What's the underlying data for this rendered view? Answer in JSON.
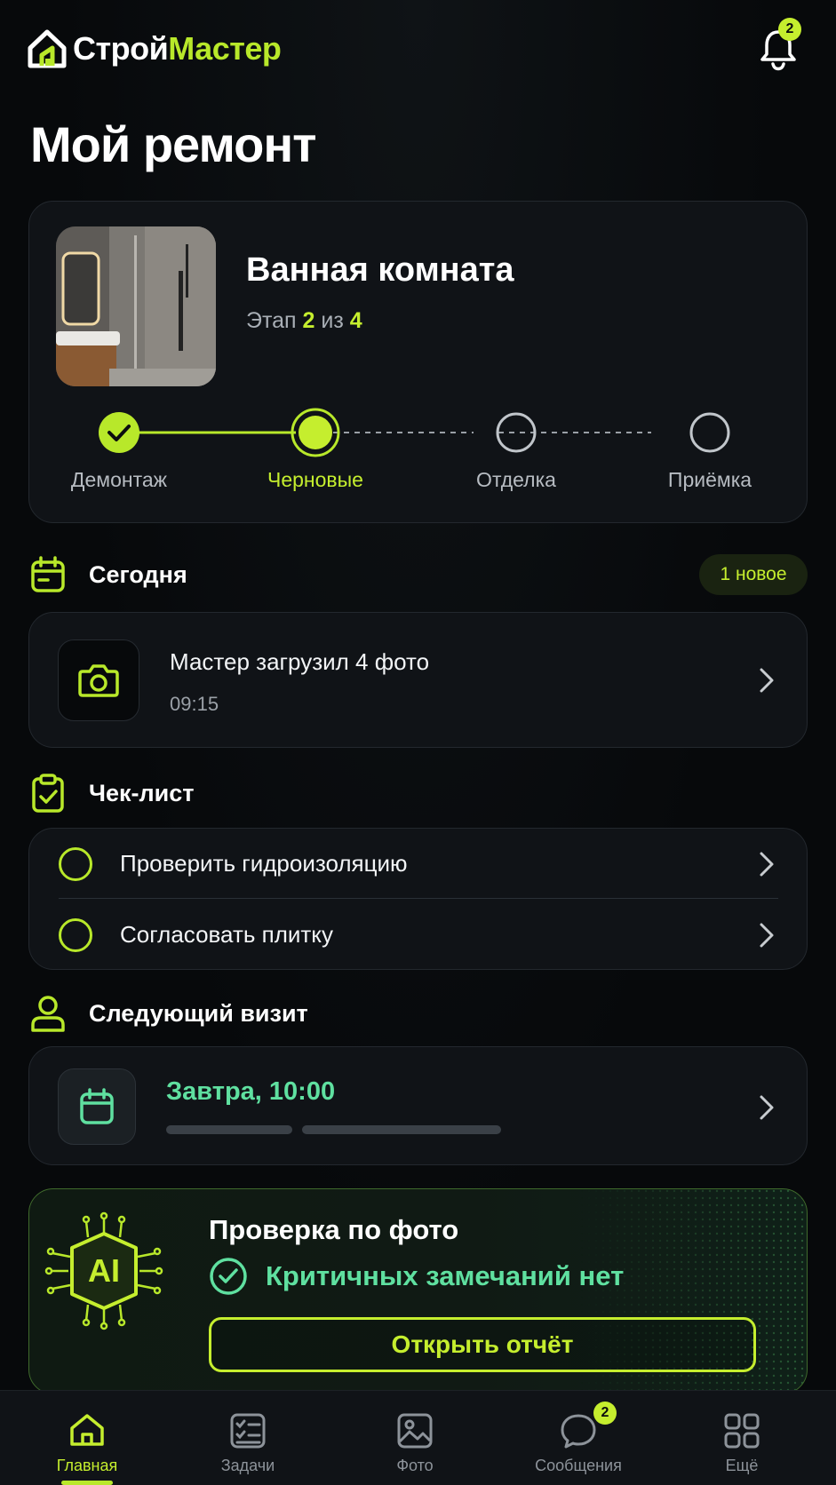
{
  "header": {
    "logo_part1": "Строй",
    "logo_part2": "Мастер",
    "notification_count": "2",
    "logo_icon": "house-icon",
    "bell_icon": "bell-icon"
  },
  "page_title": "Мой ремонт",
  "project": {
    "title": "Ванная комната",
    "stage_prefix": "Этап",
    "stage_current": "2",
    "stage_sep": "из",
    "stage_total": "4",
    "steps": [
      {
        "label": "Демонтаж",
        "state": "done"
      },
      {
        "label": "Черновые",
        "state": "current"
      },
      {
        "label": "Отделка",
        "state": "pending"
      },
      {
        "label": "Приёмка",
        "state": "pending"
      }
    ]
  },
  "today": {
    "title": "Сегодня",
    "badge": "1 новое",
    "item_title": "Мастер загрузил 4 фото",
    "item_time": "09:15",
    "icon": "camera-icon"
  },
  "checklist": {
    "title": "Чек-лист",
    "items": [
      {
        "label": "Проверить гидроизоляцию"
      },
      {
        "label": "Согласовать плитку"
      }
    ]
  },
  "visit": {
    "title": "Следующий визит",
    "time": "Завтра, 10:00"
  },
  "ai_check": {
    "badge": "AI",
    "title": "Проверка по фото",
    "status": "Критичных замечаний нет",
    "button": "Открыть отчёт"
  },
  "nav": {
    "items": [
      {
        "label": "Главная",
        "icon": "home-icon",
        "active": true
      },
      {
        "label": "Задачи",
        "icon": "tasks-icon"
      },
      {
        "label": "Фото",
        "icon": "image-icon"
      },
      {
        "label": "Сообщения",
        "icon": "chat-icon",
        "badge": "2"
      },
      {
        "label": "Ещё",
        "icon": "grid-icon"
      }
    ]
  },
  "colors": {
    "accent": "#c5ee2e",
    "mint": "#5fe0a0",
    "background": "#07090b",
    "card": "#101317"
  }
}
